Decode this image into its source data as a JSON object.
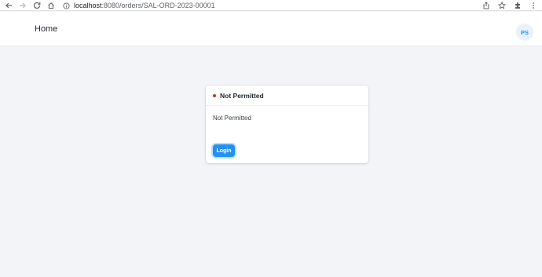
{
  "browser": {
    "url_host": "localhost",
    "url_path": ":8080/orders/SAL-ORD-2023-00001",
    "icons": [
      "back-icon",
      "forward-icon",
      "reload-icon",
      "home-icon",
      "info-icon",
      "share-icon",
      "star-icon",
      "puzzle-icon",
      "menu-icon"
    ]
  },
  "navbar": {
    "brand": "Home",
    "avatar_initials": "PS"
  },
  "card": {
    "title": "Not Permitted",
    "message": "Not Permitted",
    "button_label": "Login",
    "indicator_color": "#c0392b",
    "accent_color": "#2490ef"
  }
}
